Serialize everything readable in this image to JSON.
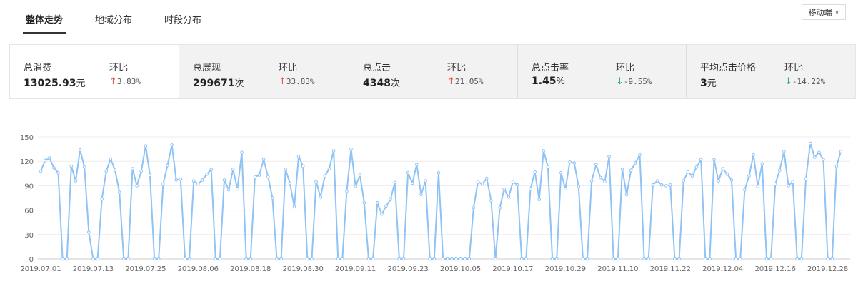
{
  "tabs": [
    "整体走势",
    "地域分布",
    "时段分布"
  ],
  "device_select": {
    "label": "移动端",
    "chevron": "chevron-down-icon"
  },
  "metrics": [
    {
      "label": "总消费",
      "value": "13025.93",
      "unit": "元",
      "compare_label": "环比",
      "compare": "3.83%",
      "direction": "up"
    },
    {
      "label": "总展现",
      "value": "299671",
      "unit": "次",
      "compare_label": "环比",
      "compare": "33.83%",
      "direction": "up"
    },
    {
      "label": "总点击",
      "value": "4348",
      "unit": "次",
      "compare_label": "环比",
      "compare": "21.05%",
      "direction": "up"
    },
    {
      "label": "总点击率",
      "value": "1.45",
      "unit": "%",
      "compare_label": "环比",
      "compare": "-9.55%",
      "direction": "down"
    },
    {
      "label": "平均点击价格",
      "value": "3",
      "unit": "元",
      "compare_label": "环比",
      "compare": "-14.22%",
      "direction": "down"
    }
  ],
  "colors": {
    "line": "#8fc3f5",
    "grid": "#ececec",
    "up": "#e5534b",
    "down": "#2fb26b"
  },
  "chart_data": {
    "type": "line",
    "grid": true,
    "ylim": [
      0,
      150
    ],
    "yticks": [
      0,
      30,
      60,
      90,
      120,
      150
    ],
    "x_tick_labels": [
      "2019.07.01",
      "2019.07.13",
      "2019.07.25",
      "2019.08.06",
      "2019.08.18",
      "2019.08.30",
      "2019.09.11",
      "2019.09.23",
      "2019.10.05",
      "2019.10.17",
      "2019.10.29",
      "2019.11.10",
      "2019.11.22",
      "2019.12.04",
      "2019.12.16",
      "2019.12.28"
    ],
    "x_start": "2019.07.01",
    "x_end": "2019.12.31",
    "series": [
      {
        "values": [
          108,
          121,
          124,
          112,
          106,
          0,
          0,
          114,
          96,
          134,
          113,
          33,
          0,
          0,
          74,
          108,
          123,
          109,
          82,
          0,
          0,
          111,
          90,
          108,
          139,
          103,
          0,
          0,
          92,
          115,
          140,
          97,
          98,
          0,
          0,
          96,
          92,
          97,
          104,
          110,
          0,
          0,
          97,
          85,
          110,
          86,
          131,
          0,
          0,
          101,
          103,
          122,
          101,
          75,
          0,
          0,
          110,
          93,
          64,
          126,
          114,
          0,
          0,
          95,
          76,
          102,
          111,
          133,
          0,
          0,
          83,
          135,
          89,
          103,
          69,
          0,
          0,
          69,
          55,
          65,
          73,
          94,
          0,
          0,
          106,
          93,
          116,
          79,
          96,
          0,
          0,
          106,
          0,
          0,
          0,
          0,
          0,
          0,
          0,
          63,
          95,
          92,
          99,
          72,
          0,
          63,
          86,
          76,
          95,
          91,
          0,
          0,
          86,
          107,
          73,
          133,
          113,
          0,
          0,
          106,
          86,
          119,
          118,
          89,
          0,
          0,
          96,
          116,
          100,
          95,
          126,
          0,
          0,
          110,
          79,
          109,
          118,
          128,
          0,
          0,
          91,
          96,
          91,
          90,
          91,
          0,
          0,
          96,
          107,
          102,
          113,
          122,
          0,
          0,
          122,
          96,
          111,
          104,
          97,
          0,
          0,
          85,
          102,
          128,
          89,
          117,
          0,
          0,
          92,
          109,
          132,
          90,
          95,
          0,
          0,
          98,
          142,
          125,
          131,
          122,
          0,
          0,
          114,
          132
        ]
      }
    ]
  }
}
